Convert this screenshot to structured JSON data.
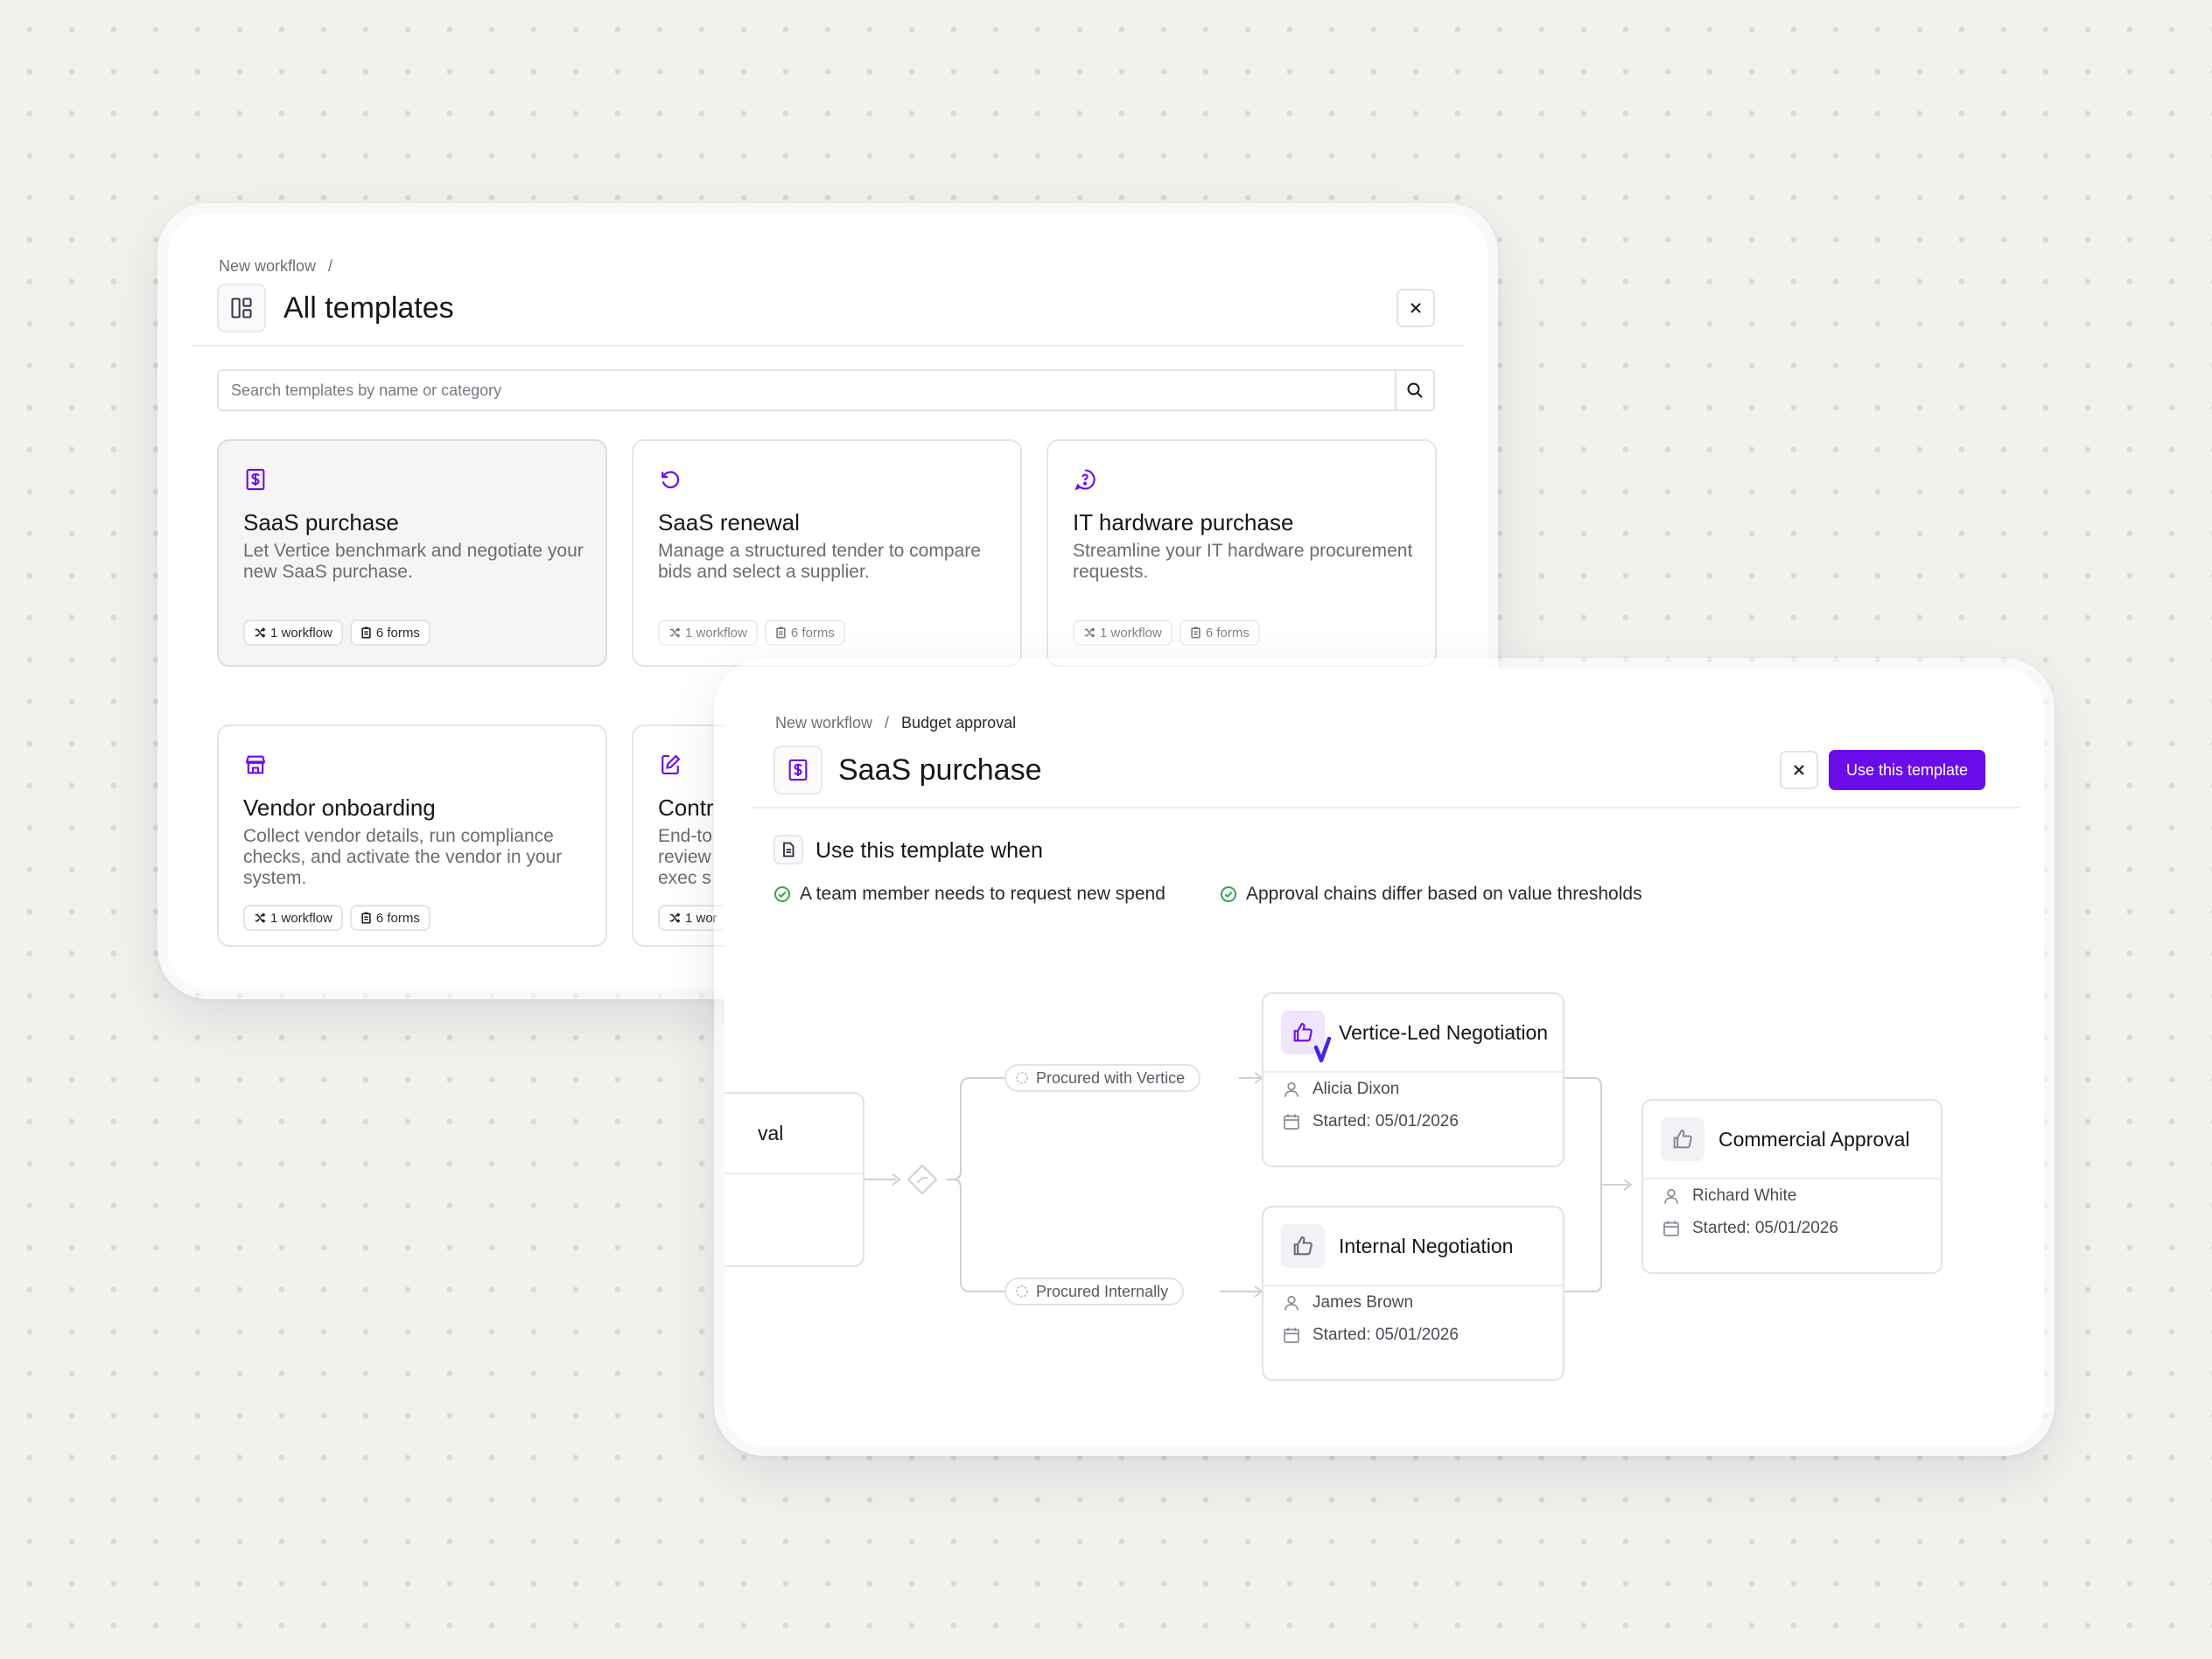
{
  "templates_panel": {
    "breadcrumb": {
      "root": "New workflow",
      "separator": "/"
    },
    "title": "All templates",
    "search": {
      "placeholder": "Search templates by name or category",
      "value": ""
    },
    "cards": [
      {
        "title": "SaaS purchase",
        "description": "Let Vertice benchmark and negotiate your new SaaS purchase.",
        "workflows": "1 workflow",
        "forms": "6 forms",
        "icon": "dollar-doc-icon",
        "selected": true
      },
      {
        "title": "SaaS renewal",
        "description": "Manage a structured tender to compare bids and select a supplier.",
        "workflows": "1 workflow",
        "forms": "6 forms",
        "icon": "refresh-icon"
      },
      {
        "title": "IT hardware purchase",
        "description": "Streamline your IT hardware procurement requests.",
        "workflows": "1 workflow",
        "forms": "6 forms",
        "icon": "help-chat-icon"
      },
      {
        "title": "Vendor onboarding",
        "description": "Collect vendor details, run compliance checks, and activate the vendor in your system.",
        "workflows": "1 workflow",
        "forms": "6 forms",
        "icon": "store-icon"
      },
      {
        "title": "Contr",
        "description": "End-to\nreview\nexec s",
        "workflows": "1 wor",
        "icon": "edit-doc-icon"
      }
    ]
  },
  "detail_panel": {
    "breadcrumb": {
      "root": "New workflow",
      "separator": "/",
      "current": "Budget approval"
    },
    "title": "SaaS purchase",
    "use_button": "Use this template",
    "when": {
      "title": "Use this template when",
      "criteria": [
        "A team member needs to request new spend",
        "Approval chains differ based on value thresholds"
      ]
    },
    "flow": {
      "partial_node_title": "val",
      "branches": [
        {
          "label": "Procured with Vertice"
        },
        {
          "label": "Procured Internally"
        }
      ],
      "nodes": [
        {
          "title": "Vertice-Led Negotiation",
          "assignee": "Alicia Dixon",
          "started": "Started: 05/01/2026",
          "active": true
        },
        {
          "title": "Internal Negotiation",
          "assignee": "James Brown",
          "started": "Started: 05/01/2026"
        },
        {
          "title": "Commercial Approval",
          "assignee": "Richard White",
          "started": "Started: 05/01/2026"
        }
      ]
    }
  },
  "colors": {
    "accent": "#6a0ce9",
    "success": "#2fa84f",
    "text": "#16161d",
    "muted": "#6b6b74"
  }
}
